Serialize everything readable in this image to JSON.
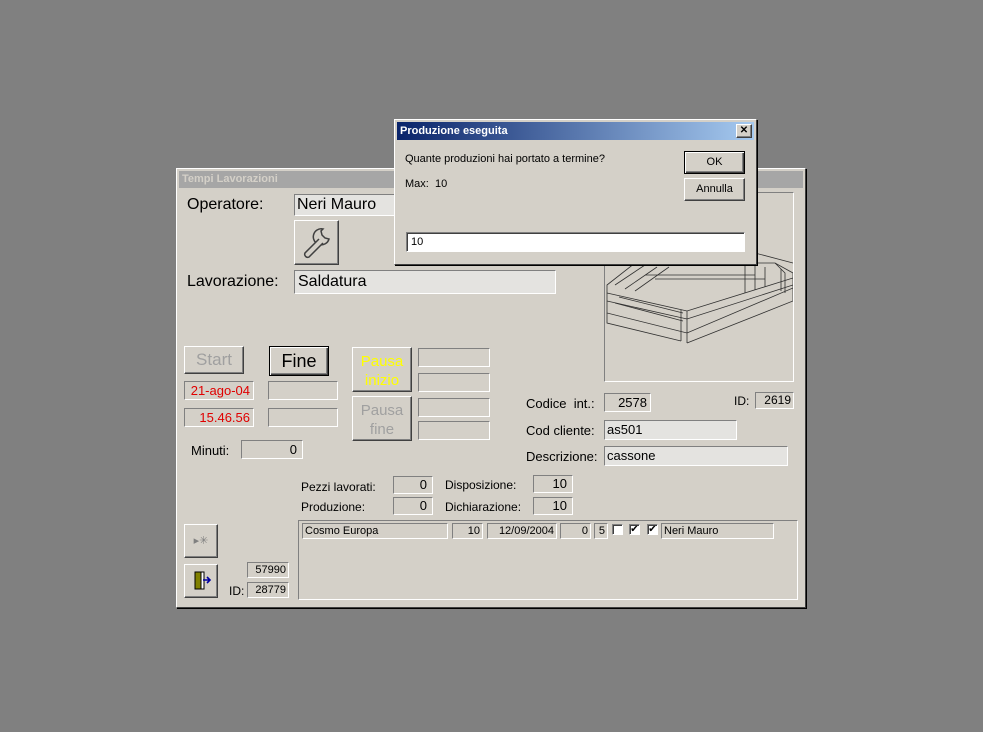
{
  "main_window": {
    "title": "Tempi Lavorazioni",
    "operatore_label": "Operatore:",
    "operatore_value": "Neri Mauro",
    "lavorazione_label": "Lavorazione:",
    "lavorazione_value": "Saldatura",
    "start_label": "Start",
    "fine_label": "Fine",
    "pausa_inizio_label": "Pausa inizio",
    "pausa_fine_label": "Pausa fine",
    "date_value": "21-ago-04",
    "time_value": "15.46.56",
    "minuti_label": "Minuti:",
    "minuti_value": "0",
    "codice_int_label": "Codice  int.:",
    "codice_int_value": "2578",
    "id_label": "ID:",
    "id_value": "2619",
    "cod_cliente_label": "Cod cliente:",
    "cod_cliente_value": "as501",
    "descrizione_label": "Descrizione:",
    "descrizione_value": "cassone",
    "pezzi_lavorati_label": "Pezzi lavorati:",
    "pezzi_lavorati_value": "0",
    "produzione_label": "Produzione:",
    "produzione_value": "0",
    "disposizione_label": "Disposizione:",
    "disposizione_value": "10",
    "dichiarazione_label": "Dichiarazione:",
    "dichiarazione_value": "10",
    "record_value": "57990",
    "bottom_id_label": "ID:",
    "bottom_id_value": "28779",
    "subform_row": {
      "cliente": "Cosmo Europa",
      "qty": "10",
      "date": "12/09/2004",
      "n1": "0",
      "n2": "5",
      "check1": false,
      "check2": true,
      "check3": true,
      "operatore": "Neri Mauro"
    }
  },
  "dialog": {
    "title": "Produzione eseguita",
    "prompt": "Quante produzioni hai portato a termine?",
    "max_text": "Max:  10",
    "ok_label": "OK",
    "cancel_label": "Annulla",
    "input_value": "10",
    "close_symbol": "✕"
  }
}
